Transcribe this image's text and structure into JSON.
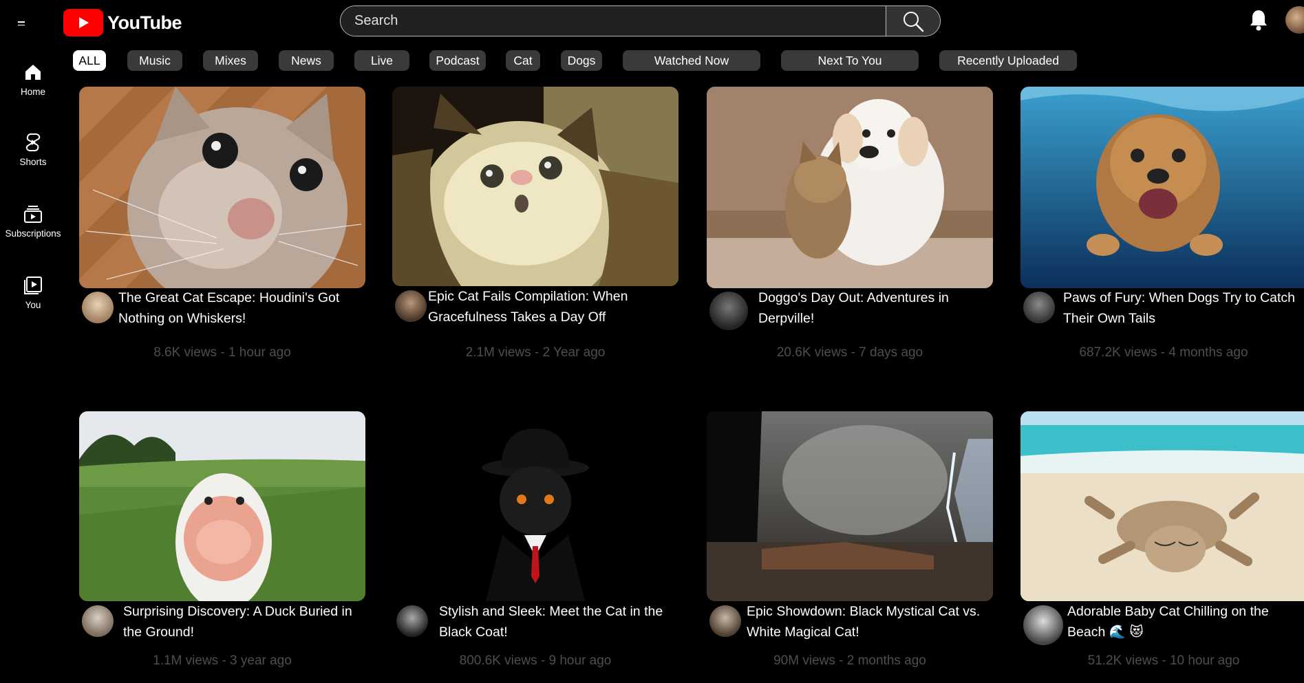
{
  "header": {
    "logo_text": "YouTube",
    "search_placeholder": "Search"
  },
  "sidebar": {
    "items": [
      {
        "label": "Home"
      },
      {
        "label": "Shorts"
      },
      {
        "label": "Subscriptions"
      },
      {
        "label": "You"
      }
    ]
  },
  "chips": [
    "ALL",
    "Music",
    "Mixes",
    "News",
    "Live",
    "Podcast",
    "Cat",
    "Dogs",
    "Watched Now",
    "Next To You",
    "Recently Uploaded"
  ],
  "videos": [
    {
      "title_1": "The Great Cat Escape: Houdini's Got",
      "title_2": "Nothing on Whiskers!",
      "meta": "8.6K views - 1 hour ago"
    },
    {
      "title_1": "Epic Cat Fails Compilation: When",
      "title_2": "Gracefulness Takes a Day Off",
      "meta": "2.1M views - 2 Year ago"
    },
    {
      "title_1": "Doggo's Day Out: Adventures in",
      "title_2": "Derpville!",
      "meta": "20.6K views - 7 days ago"
    },
    {
      "title_1": "Paws of Fury: When Dogs Try to Catch",
      "title_2": "Their Own Tails",
      "meta": "687.2K views - 4 months ago"
    },
    {
      "title_1": "Surprising Discovery: A Duck Buried in",
      "title_2": "the Ground!",
      "meta": "1.1M views - 3 year ago"
    },
    {
      "title_1": "Stylish and Sleek: Meet the Cat in the",
      "title_2": "Black Coat!",
      "meta": "800.6K views - 9 hour ago"
    },
    {
      "title_1": "Epic Showdown: Black Mystical Cat vs.",
      "title_2": "White Magical Cat!",
      "meta": "90M views - 2 months ago"
    },
    {
      "title_1": "Adorable Baby Cat Chilling on the",
      "title_2": "Beach 🌊 😻",
      "meta": "51.2K views - 10 hour ago"
    }
  ],
  "colors": {
    "brand_red": "#ff0000",
    "chip_bg": "#3a3a3a",
    "meta_text": "#4e4e4e"
  }
}
